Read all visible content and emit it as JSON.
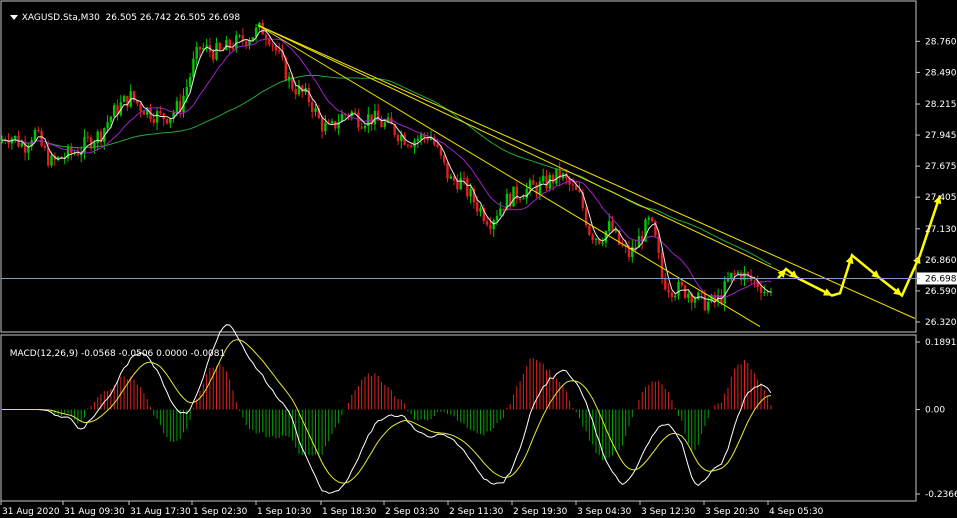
{
  "header": {
    "symbol_info": "XAGUSD.Sta,M30  26.505 26.742 26.505 26.698",
    "macd_info": "MACD(12,26,9) -0.0568 -0.0506 0.0000 -0.0081"
  },
  "chart_data": [
    {
      "type": "candlestick",
      "title": "XAGUSD.Sta,M30",
      "instrument": "XAGUSD.Sta",
      "timeframe": "M30",
      "ohlc_last": {
        "open": 26.505,
        "high": 26.742,
        "low": 26.505,
        "close": 26.698
      },
      "current_price": 26.698,
      "ylim": [
        26.25,
        29.05
      ],
      "y_ticks": [
        "28.760",
        "28.490",
        "28.215",
        "27.945",
        "27.675",
        "27.405",
        "27.130",
        "26.860",
        "26.698",
        "26.590",
        "26.320"
      ],
      "x_tick_labels": [
        "31 Aug 2020",
        "31 Aug 09:30",
        "31 Aug 17:30",
        "1 Sep 02:30",
        "1 Sep 10:30",
        "1 Sep 18:30",
        "2 Sep 03:30",
        "2 Sep 11:30",
        "2 Sep 19:30",
        "3 Sep 04:30",
        "3 Sep 12:30",
        "3 Sep 20:30",
        "4 Sep 05:30"
      ],
      "price_path": [
        [
          0,
          27.88
        ],
        [
          6,
          27.95
        ],
        [
          14,
          27.92
        ],
        [
          24,
          27.85
        ],
        [
          34,
          27.98
        ],
        [
          44,
          27.8
        ],
        [
          52,
          27.7
        ],
        [
          60,
          27.74
        ],
        [
          70,
          27.78
        ],
        [
          80,
          27.82
        ],
        [
          90,
          27.9
        ],
        [
          100,
          27.95
        ],
        [
          110,
          28.1
        ],
        [
          120,
          28.2
        ],
        [
          130,
          28.28
        ],
        [
          140,
          28.2
        ],
        [
          150,
          28.15
        ],
        [
          160,
          28.1
        ],
        [
          170,
          28.12
        ],
        [
          180,
          28.2
        ],
        [
          188,
          28.4
        ],
        [
          194,
          28.58
        ],
        [
          200,
          28.7
        ],
        [
          210,
          28.68
        ],
        [
          220,
          28.66
        ],
        [
          230,
          28.72
        ],
        [
          240,
          28.76
        ],
        [
          252,
          28.82
        ],
        [
          262,
          28.87
        ],
        [
          270,
          28.8
        ],
        [
          280,
          28.6
        ],
        [
          290,
          28.4
        ],
        [
          300,
          28.32
        ],
        [
          310,
          28.25
        ],
        [
          320,
          28.05
        ],
        [
          330,
          27.98
        ],
        [
          340,
          28.1
        ],
        [
          350,
          28.15
        ],
        [
          360,
          28.08
        ],
        [
          370,
          28.1
        ],
        [
          380,
          28.05
        ],
        [
          390,
          28.02
        ],
        [
          400,
          27.95
        ],
        [
          410,
          27.9
        ],
        [
          420,
          27.92
        ],
        [
          430,
          27.95
        ],
        [
          440,
          27.75
        ],
        [
          450,
          27.55
        ],
        [
          460,
          27.55
        ],
        [
          470,
          27.42
        ],
        [
          480,
          27.3
        ],
        [
          490,
          27.2
        ],
        [
          500,
          27.32
        ],
        [
          510,
          27.4
        ],
        [
          520,
          27.45
        ],
        [
          530,
          27.48
        ],
        [
          540,
          27.5
        ],
        [
          550,
          27.55
        ],
        [
          560,
          27.6
        ],
        [
          570,
          27.5
        ],
        [
          580,
          27.4
        ],
        [
          590,
          27.1
        ],
        [
          600,
          27.05
        ],
        [
          610,
          27.15
        ],
        [
          620,
          26.98
        ],
        [
          630,
          26.9
        ],
        [
          640,
          27.05
        ],
        [
          650,
          27.2
        ],
        [
          656,
          27.0
        ],
        [
          662,
          26.7
        ],
        [
          670,
          26.62
        ],
        [
          680,
          26.6
        ],
        [
          690,
          26.58
        ],
        [
          700,
          26.5
        ],
        [
          710,
          26.48
        ],
        [
          720,
          26.52
        ],
        [
          730,
          26.7
        ],
        [
          740,
          26.75
        ],
        [
          750,
          26.68
        ],
        [
          760,
          26.65
        ],
        [
          768,
          26.55
        ],
        [
          773,
          26.7
        ]
      ],
      "forecast_path": [
        [
          778,
          26.7
        ],
        [
          786,
          26.78
        ],
        [
          798,
          26.7
        ],
        [
          832,
          26.55
        ],
        [
          840,
          26.57
        ],
        [
          852,
          26.9
        ],
        [
          880,
          26.7
        ],
        [
          902,
          26.55
        ],
        [
          920,
          26.9
        ],
        [
          940,
          27.42
        ]
      ],
      "trendlines": [
        {
          "from": [
            258,
            28.9
          ],
          "to": [
            915,
            26.35
          ],
          "color": "#f2e200"
        },
        {
          "from": [
            258,
            28.9
          ],
          "to": [
            790,
            26.72
          ],
          "color": "#f2e200"
        },
        {
          "from": [
            258,
            28.9
          ],
          "to": [
            760,
            26.28
          ],
          "color": "#f2e200"
        }
      ],
      "moving_averages": [
        {
          "color": "#22a83a",
          "role": "slow"
        },
        {
          "color": "#a020c8",
          "role": "medium"
        },
        {
          "color": "#e8e8e8",
          "role": "fast"
        }
      ],
      "colors": {
        "bull_candle": "#00c800",
        "bear_candle": "#e02020",
        "forecast": "#ffff00",
        "price_line": "#7f9fbf"
      }
    },
    {
      "type": "macd",
      "title": "MACD(12,26,9)",
      "values": {
        "histogram": -0.0568,
        "signal": -0.0506,
        "zero": 0.0,
        "diff": -0.0081
      },
      "ylim": [
        -0.2366,
        0.1891
      ],
      "y_ticks": [
        "0.1891",
        "0.00",
        "-0.2366"
      ],
      "colors": {
        "macd_line": "#ffffff",
        "signal_line": "#e8e83a",
        "hist_pos": "#e02020",
        "hist_neg": "#00a000"
      }
    }
  ]
}
